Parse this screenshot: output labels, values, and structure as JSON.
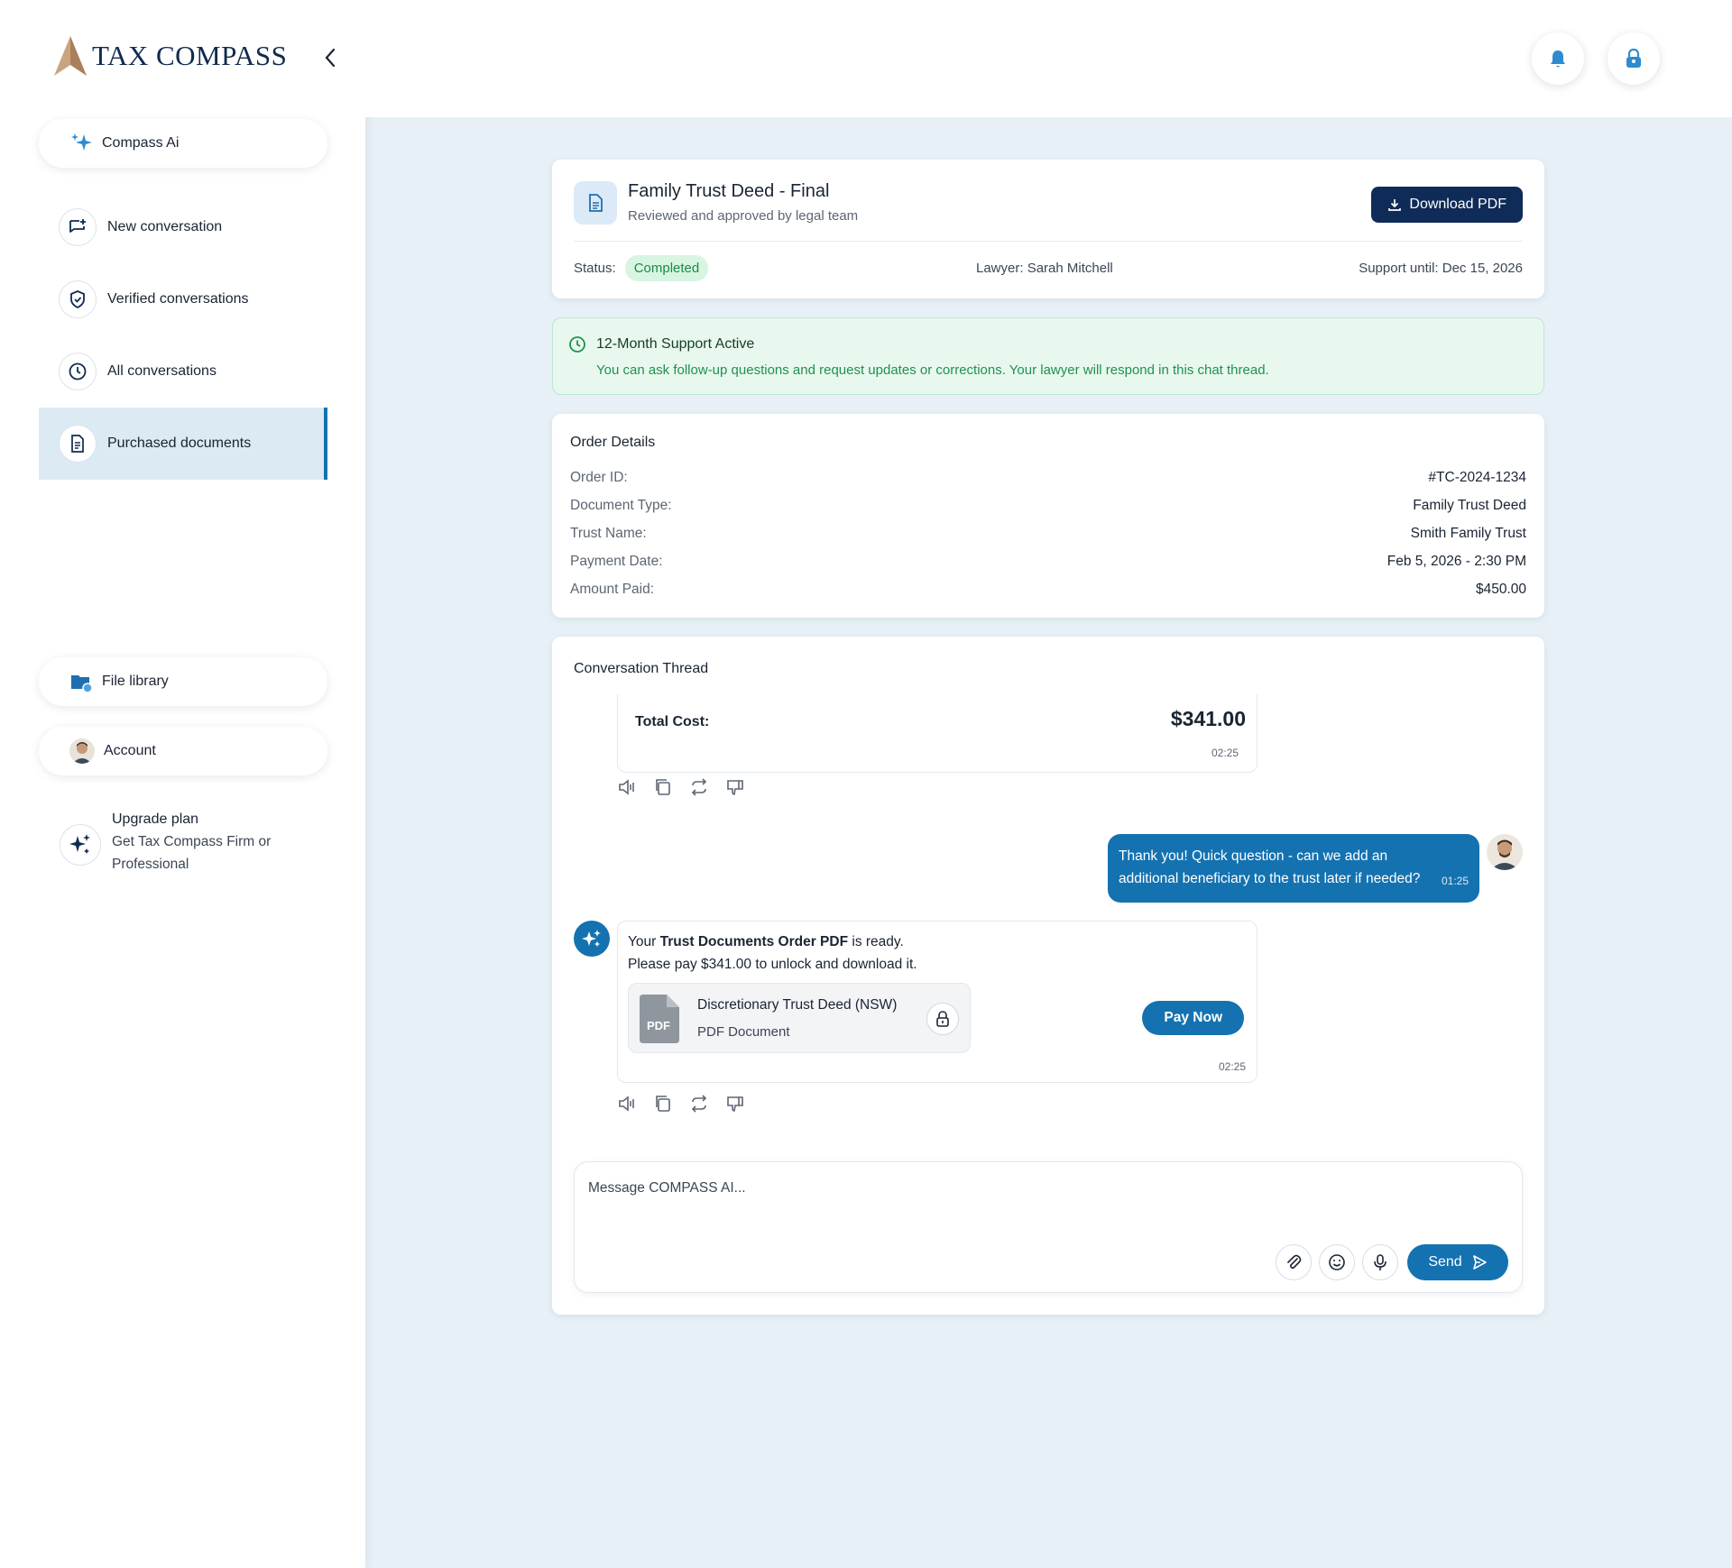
{
  "brand": {
    "name": "TAX COMPASS"
  },
  "sidebar": {
    "compass_ai": "Compass Ai",
    "items": [
      {
        "label": "New conversation",
        "icon": "chat-plus-icon"
      },
      {
        "label": "Verified conversations",
        "icon": "shield-check-icon"
      },
      {
        "label": "All conversations",
        "icon": "clock-icon"
      },
      {
        "label": "Purchased documents",
        "icon": "document-icon",
        "active": true
      }
    ],
    "file_library": "File library",
    "account": "Account",
    "upgrade": {
      "title": "Upgrade plan",
      "subtitle": "Get Tax Compass Firm or Professional"
    }
  },
  "document": {
    "title": "Family Trust Deed - Final",
    "subtitle": "Reviewed and approved by legal team",
    "download_label": "Download PDF",
    "status_label": "Status:",
    "status_value": "Completed",
    "lawyer": "Lawyer: Sarah Mitchell",
    "support_until": "Support until: Dec 15, 2026"
  },
  "support_banner": {
    "title": "12-Month Support Active",
    "text": "You can ask follow-up questions and request updates or corrections. Your lawyer will respond in this chat thread."
  },
  "order": {
    "title": "Order Details",
    "rows": [
      {
        "key": "Order ID:",
        "value": "#TC-2024-1234"
      },
      {
        "key": "Document Type:",
        "value": "Family Trust Deed"
      },
      {
        "key": "Trust Name:",
        "value": "Smith Family Trust"
      },
      {
        "key": "Payment Date:",
        "value": "Feb 5, 2026 - 2:30 PM"
      },
      {
        "key": "Amount Paid:",
        "value": "$450.00"
      }
    ]
  },
  "thread": {
    "title": "Conversation Thread",
    "total_label": "Total Cost:",
    "total_value": "$341.00",
    "total_time": "02:25",
    "user_message": "Thank you! Quick question - can we add an additional beneficiary to the trust later if needed?",
    "user_time": "01:25",
    "ai_msg_prefix": "Your ",
    "ai_msg_bold": "Trust Documents Order PDF",
    "ai_msg_suffix": " is ready.",
    "ai_msg_line2": "Please pay $341.00 to unlock and download it.",
    "file_name": "Discretionary Trust Deed (NSW)",
    "file_type": "PDF Document",
    "file_badge": "PDF",
    "pay_label": "Pay Now",
    "ai_time": "02:25"
  },
  "composer": {
    "placeholder": "Message COMPASS AI...",
    "send_label": "Send"
  },
  "colors": {
    "primary": "#1472b0",
    "navy": "#0f2b57",
    "success": "#1c8a48",
    "background": "#e6f0f6"
  }
}
